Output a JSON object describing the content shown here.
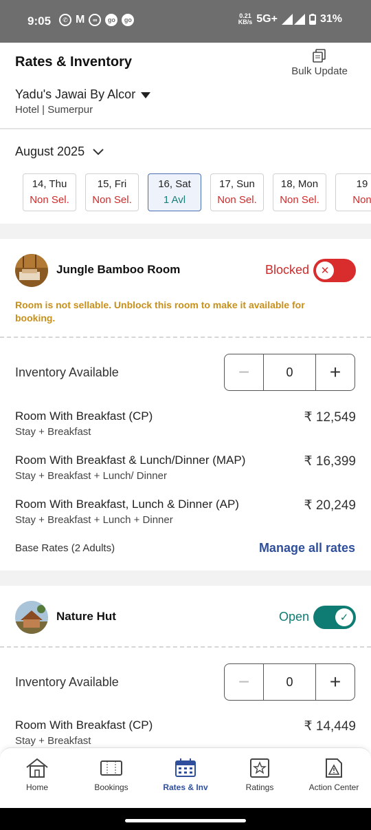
{
  "status_bar": {
    "time": "9:05",
    "speed_top": "0.21",
    "speed_unit": "KB/s",
    "network": "5G+",
    "battery": "31%"
  },
  "header": {
    "title": "Rates & Inventory",
    "bulk_update": "Bulk Update",
    "hotel_name": "Yadu's Jawai By Alcor",
    "hotel_sub": "Hotel | Sumerpur"
  },
  "month": "August 2025",
  "dates": [
    {
      "day": "14, Thu",
      "status": "Non Sel."
    },
    {
      "day": "15, Fri",
      "status": "Non Sel."
    },
    {
      "day": "16, Sat",
      "status": "1 Avl",
      "selected": true
    },
    {
      "day": "17, Sun",
      "status": "Non Sel."
    },
    {
      "day": "18, Mon",
      "status": "Non Sel."
    },
    {
      "day": "19",
      "status": "Non"
    }
  ],
  "rooms": [
    {
      "name": "Jungle Bamboo Room",
      "status": "Blocked",
      "warning": "Room is not sellable. Unblock this room to make it available for booking.",
      "inventory_label": "Inventory Available",
      "inventory_value": "0",
      "rates": [
        {
          "name": "Room With Breakfast (CP)",
          "desc": "Stay + Breakfast",
          "price": "₹ 12,549"
        },
        {
          "name": "Room With Breakfast & Lunch/Dinner (MAP)",
          "desc": "Stay + Breakfast + Lunch/ Dinner",
          "price": "₹ 16,399"
        },
        {
          "name": "Room With Breakfast, Lunch & Dinner (AP)",
          "desc": "Stay + Breakfast + Lunch + Dinner",
          "price": "₹ 20,249"
        }
      ],
      "base_rates": "Base Rates (2 Adults)",
      "manage": "Manage all rates"
    },
    {
      "name": "Nature Hut",
      "status": "Open",
      "inventory_label": "Inventory Available",
      "inventory_value": "0",
      "rates": [
        {
          "name": "Room With Breakfast (CP)",
          "desc": "Stay + Breakfast",
          "price": "₹ 14,449"
        }
      ]
    }
  ],
  "nav": [
    "Home",
    "Bookings",
    "Rates & Inv",
    "Ratings",
    "Action Center"
  ],
  "colors": {
    "blocked": "#d02a2a",
    "open": "#0e7c73",
    "accent": "#2f4f9c",
    "warning": "#c8901a"
  }
}
